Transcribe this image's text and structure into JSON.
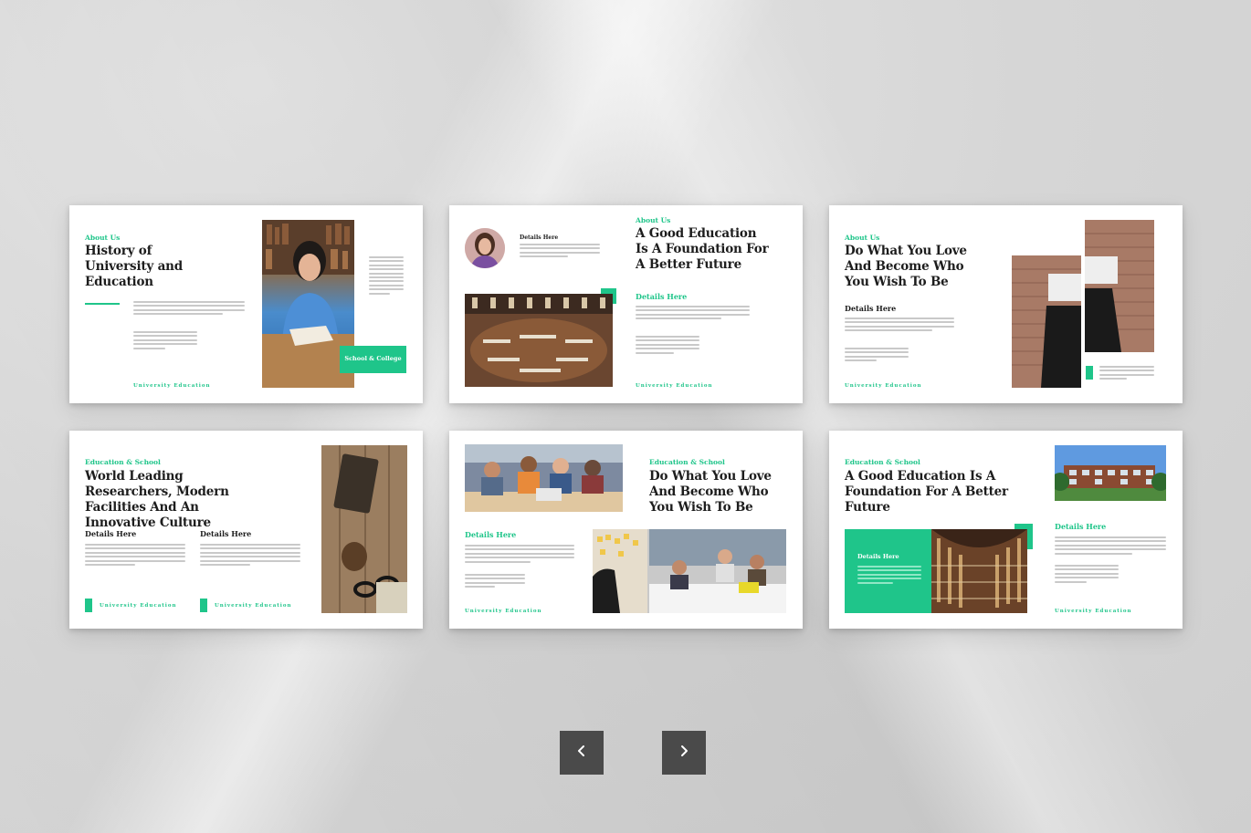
{
  "slides": [
    {
      "eyebrow": "About Us",
      "title": "History of University and Education",
      "badge": "School & College",
      "footer": "University Education"
    },
    {
      "eyebrow": "About Us",
      "title": "A Good Education Is A Foundation For A Better Future",
      "details_top": "Details Here",
      "details": "Details Here",
      "footer": "University Education"
    },
    {
      "eyebrow": "About Us",
      "title": "Do What You Love And Become Who You Wish To Be",
      "details": "Details Here",
      "footer": "University Education"
    },
    {
      "eyebrow": "Education & School",
      "title": "World Leading Researchers, Modern Facilities And An Innovative Culture",
      "details_left": "Details Here",
      "details_right": "Details Here",
      "footer_left": "University Education",
      "footer_right": "University Education"
    },
    {
      "eyebrow": "Education & School",
      "title": "Do What You Love And Become Who You Wish To Be",
      "details": "Details Here",
      "footer": "University Education"
    },
    {
      "eyebrow": "Education & School",
      "title": "A Good Education Is A Foundation For A Better Future",
      "details_card": "Details Here",
      "details": "Details Here",
      "footer": "University Education"
    }
  ],
  "navigation": {
    "prev_icon": "chevron-left-icon",
    "next_icon": "chevron-right-icon"
  },
  "colors": {
    "accent": "#1fc58a",
    "title": "#1d1d1d",
    "nav_button": "#4a4a4a"
  }
}
